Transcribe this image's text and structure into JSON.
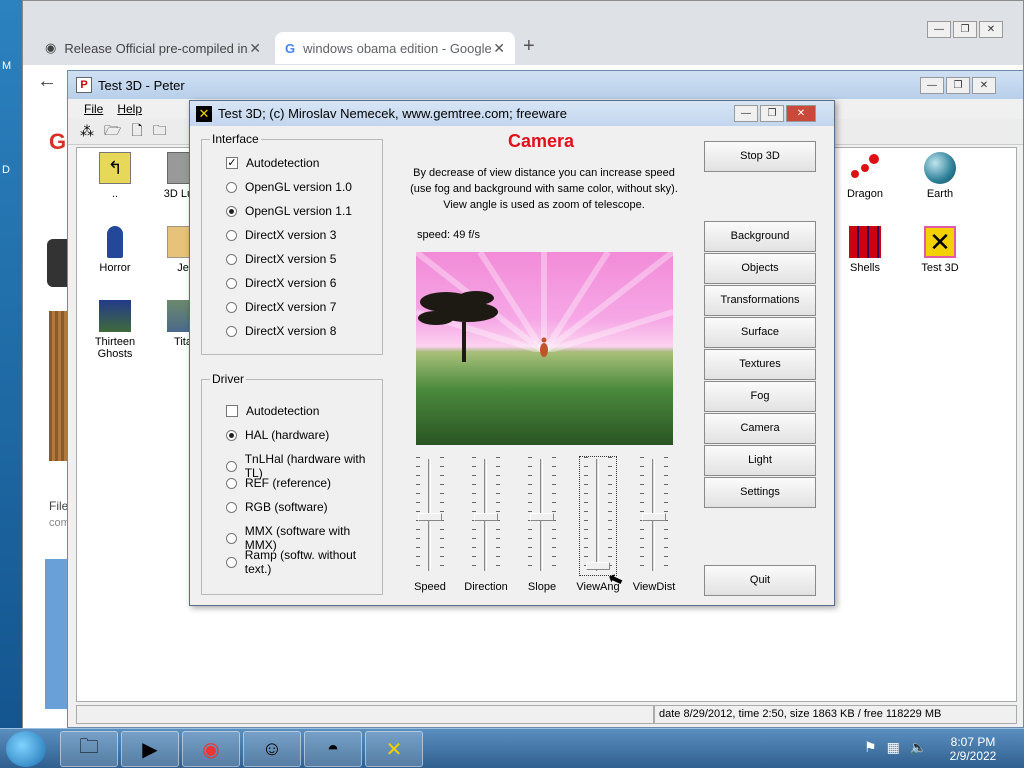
{
  "desktop": {
    "labels": [
      "M",
      "D"
    ]
  },
  "chrome": {
    "tabs": [
      {
        "label": "Release Official pre-compiled in...",
        "icon": "github-icon"
      },
      {
        "label": "windows obama edition - Google",
        "icon": "google-icon"
      }
    ],
    "new_tab": "+",
    "back": "←",
    "g_letter": "G",
    "side_file": "File",
    "side_com": "com"
  },
  "peter": {
    "title": "Test 3D - Peter",
    "menu": [
      "File",
      "Help"
    ],
    "icons": [
      "..",
      "3D Lum",
      "Horror",
      "Je",
      "Thirteen Ghosts",
      "Tita",
      "Dragon",
      "Earth",
      "Shells",
      "Test 3D"
    ],
    "status": "date 8/29/2012, time 2:50, size 1863 KB / free 118229 MB"
  },
  "dialog": {
    "title": "Test 3D;  (c) Miroslav Nemecek, www.gemtree.com;   freeware",
    "heading": "Camera",
    "desc": [
      "By decrease of view distance you can increase speed",
      "(use fog and background with same color, without sky).",
      "View angle is used as zoom of telescope."
    ],
    "speed": "speed: 49 f/s",
    "interface": {
      "legend": "Interface",
      "options": [
        {
          "label": "Autodetection",
          "kind": "check",
          "checked": true
        },
        {
          "label": "OpenGL version 1.0",
          "kind": "radio",
          "checked": false
        },
        {
          "label": "OpenGL version 1.1",
          "kind": "radio",
          "checked": true
        },
        {
          "label": "DirectX version 3",
          "kind": "radio",
          "checked": false
        },
        {
          "label": "DirectX version 5",
          "kind": "radio",
          "checked": false
        },
        {
          "label": "DirectX version 6",
          "kind": "radio",
          "checked": false
        },
        {
          "label": "DirectX version 7",
          "kind": "radio",
          "checked": false
        },
        {
          "label": "DirectX version 8",
          "kind": "radio",
          "checked": false
        }
      ]
    },
    "driver": {
      "legend": "Driver",
      "options": [
        {
          "label": "Autodetection",
          "kind": "check",
          "checked": false
        },
        {
          "label": "HAL (hardware)",
          "kind": "radio",
          "checked": true
        },
        {
          "label": "TnLHal (hardware with TL)",
          "kind": "radio",
          "checked": false
        },
        {
          "label": "REF (reference)",
          "kind": "radio",
          "checked": false
        },
        {
          "label": "RGB (software)",
          "kind": "radio",
          "checked": false
        },
        {
          "label": "MMX (software with MMX)",
          "kind": "radio",
          "checked": false
        },
        {
          "label": "Ramp (softw. without text.)",
          "kind": "radio",
          "checked": false
        }
      ]
    },
    "sliders": [
      {
        "label": "Speed",
        "level": 0.5
      },
      {
        "label": "Direction",
        "level": 0.5
      },
      {
        "label": "Slope",
        "level": 0.5
      },
      {
        "label": "ViewAng",
        "level": 0.05
      },
      {
        "label": "ViewDist",
        "level": 0.5
      }
    ],
    "buttons": {
      "stop": "Stop 3D",
      "background": "Background",
      "objects": "Objects",
      "transformations": "Transformations",
      "surface": "Surface",
      "textures": "Textures",
      "fog": "Fog",
      "camera": "Camera",
      "light": "Light",
      "settings": "Settings",
      "quit": "Quit"
    }
  },
  "taskbar": {
    "time": "8:07 PM",
    "date": "2/9/2022"
  }
}
